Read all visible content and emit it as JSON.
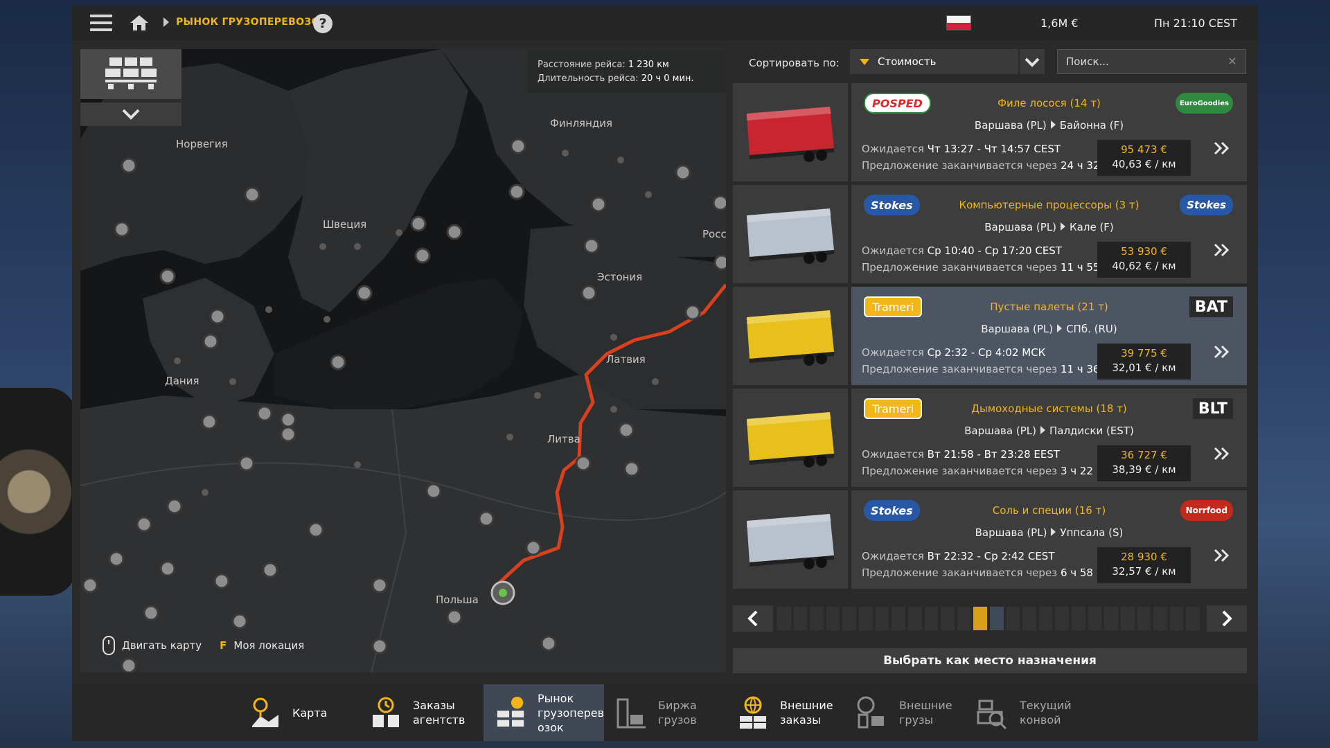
{
  "topbar": {
    "title": "РЫНОК ГРУЗОПЕРЕВОЗОК",
    "help": "?",
    "money": "1,6M  €",
    "clock": "Пн 21:10 CEST"
  },
  "map": {
    "route_distance_label": "Расстояние рейса:",
    "route_distance": "1 230 км",
    "route_duration_label": "Длительность рейса:",
    "route_duration": "20 ч 0 мин.",
    "labels": {
      "norway": "Норвегия",
      "sweden": "Швеция",
      "finland": "Финляндия",
      "estonia": "Эстония",
      "latvia": "Латвия",
      "lithuania": "Литва",
      "denmark": "Дания",
      "poland": "Польша",
      "russia": "Росс"
    },
    "hint_move": "Двигать карту",
    "hint_key": "F",
    "hint_location": "Моя локация"
  },
  "sort": {
    "label": "Сортировать по:",
    "value": "Стоимость"
  },
  "search": {
    "placeholder": "Поиск..."
  },
  "jobs": [
    {
      "company_left": "POSPED",
      "company_right": "EuroGoodies",
      "cargo": "Филе лосося (14 т)",
      "from": "Варшава (PL)",
      "to": "Байонна (F)",
      "expected_label": "Ожидается",
      "expected": "Чт 13:27 - Чт 14:57 CEST",
      "offer_label": "Предложение заканчивается через",
      "offer": "24 ч 32",
      "price": "95 473 €",
      "per_km": "40,63 € / км",
      "trailer_color": "#c9252f"
    },
    {
      "company_left": "Stokes",
      "company_right": "Stokes",
      "cargo": "Компьютерные процессоры (3 т)",
      "from": "Варшава (PL)",
      "to": "Кале (F)",
      "expected_label": "Ожидается",
      "expected": "Ср 10:40 - Ср 17:20 CEST",
      "offer_label": "Предложение заканчивается через",
      "offer": "11 ч 55",
      "price": "53 930 €",
      "per_km": "40,62 € / км",
      "trailer_color": "#b9c1cc"
    },
    {
      "company_left": "Trameri",
      "company_right": "BAT",
      "cargo": "Пустые палеты (21 т)",
      "from": "Варшава (PL)",
      "to": "СПб. (RU)",
      "expected_label": "Ожидается",
      "expected": "Ср 2:32 - Ср 4:02 МСК",
      "offer_label": "Предложение заканчивается через",
      "offer": "11 ч 36",
      "price": "39 775 €",
      "per_km": "32,01 € / км",
      "trailer_color": "#e7c01b"
    },
    {
      "company_left": "Trameri",
      "company_right": "BLT",
      "cargo": "Дымоходные системы (18 т)",
      "from": "Варшава (PL)",
      "to": "Палдиски (EST)",
      "expected_label": "Ожидается",
      "expected": "Вт 21:58 - Вт 23:28 EEST",
      "offer_label": "Предложение заканчивается через",
      "offer": "3 ч 22",
      "price": "36 727 €",
      "per_km": "38,39 € / км",
      "trailer_color": "#e7c01b"
    },
    {
      "company_left": "Stokes",
      "company_right": "Norrfood",
      "cargo": "Соль и специи (16 т)",
      "from": "Варшава (PL)",
      "to": "Уппсала (S)",
      "expected_label": "Ожидается",
      "expected": "Вт 22:32 - Ср 2:42 CEST",
      "offer_label": "Предложение заканчивается через",
      "offer": "6 ч 58",
      "price": "28 930 €",
      "per_km": "32,57 € / км",
      "trailer_color": "#b9c1cc"
    }
  ],
  "pager": {
    "total_pages": 26,
    "current_page": 12
  },
  "destination_button": "Выбрать как место назначения",
  "bottom_tabs": [
    {
      "line1": "Карта",
      "line2": "",
      "line3": ""
    },
    {
      "line1": "Заказы",
      "line2": "агентств",
      "line3": ""
    },
    {
      "line1": "Рынок",
      "line2": "грузоперев",
      "line3": "озок"
    },
    {
      "line1": "Биржа",
      "line2": "грузов",
      "line3": ""
    },
    {
      "line1": "Внешние",
      "line2": "заказы",
      "line3": ""
    },
    {
      "line1": "Внешние",
      "line2": "грузы",
      "line3": ""
    },
    {
      "line1": "Текущий",
      "line2": "конвой",
      "line3": ""
    }
  ],
  "colors": {
    "accent": "#f2b61b",
    "route": "#d8401e"
  }
}
